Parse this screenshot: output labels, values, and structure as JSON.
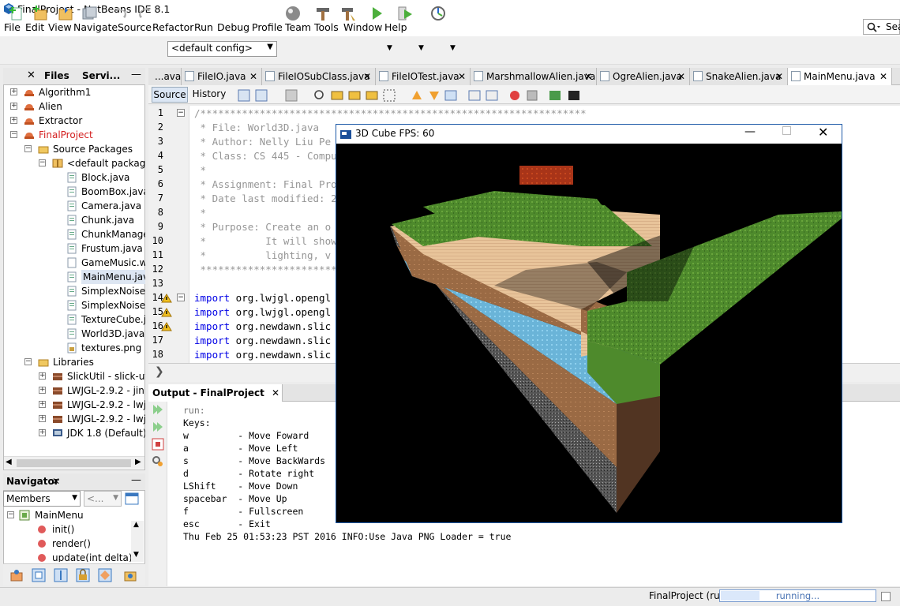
{
  "window": {
    "title": "FinalProject - NetBeans IDE 8.1"
  },
  "menu": [
    "File",
    "Edit",
    "View",
    "Navigate",
    "Source",
    "Refactor",
    "Run",
    "Debug",
    "Profile",
    "Team",
    "Tools",
    "Window",
    "Help"
  ],
  "search": {
    "value": "Sea"
  },
  "toolbar": {
    "config": "<default config>"
  },
  "projects_pane": {
    "tabs": [
      "Files",
      "Servi..."
    ],
    "items": [
      {
        "label": "Algorithm1",
        "level": 0,
        "type": "project"
      },
      {
        "label": "Alien",
        "level": 0,
        "type": "project"
      },
      {
        "label": "Extractor",
        "level": 0,
        "type": "project"
      },
      {
        "label": "FinalProject",
        "level": 0,
        "type": "project-main"
      },
      {
        "label": "Source Packages",
        "level": 1,
        "type": "folder"
      },
      {
        "label": "<default package>",
        "level": 2,
        "type": "package"
      },
      {
        "label": "Block.java",
        "level": 3,
        "type": "java"
      },
      {
        "label": "BoomBox.java",
        "level": 3,
        "type": "java"
      },
      {
        "label": "Camera.java",
        "level": 3,
        "type": "java"
      },
      {
        "label": "Chunk.java",
        "level": 3,
        "type": "java"
      },
      {
        "label": "ChunkManager.j",
        "level": 3,
        "type": "java"
      },
      {
        "label": "Frustum.java",
        "level": 3,
        "type": "java"
      },
      {
        "label": "GameMusic.wav",
        "level": 3,
        "type": "file"
      },
      {
        "label": "MainMenu.java",
        "level": 3,
        "type": "java-selected"
      },
      {
        "label": "SimplexNoise.jav",
        "level": 3,
        "type": "java"
      },
      {
        "label": "SimplexNoise_oc",
        "level": 3,
        "type": "java"
      },
      {
        "label": "TextureCube.jav",
        "level": 3,
        "type": "java"
      },
      {
        "label": "World3D.java",
        "level": 3,
        "type": "java"
      },
      {
        "label": "textures.png",
        "level": 3,
        "type": "image"
      },
      {
        "label": "Libraries",
        "level": 1,
        "type": "folder"
      },
      {
        "label": "SlickUtil - slick-util.jar",
        "level": 2,
        "type": "jar"
      },
      {
        "label": "LWJGL-2.9.2 - jinput",
        "level": 2,
        "type": "jar"
      },
      {
        "label": "LWJGL-2.9.2 - lwjgl.",
        "level": 2,
        "type": "jar"
      },
      {
        "label": "LWJGL-2.9.2 - lwjgl_",
        "level": 2,
        "type": "jar"
      },
      {
        "label": "JDK 1.8 (Default)",
        "level": 2,
        "type": "jdk"
      }
    ]
  },
  "navigator": {
    "title": "Navigator",
    "filter": "Members",
    "filter2": "<...",
    "root": "MainMenu",
    "members": [
      "init()",
      "render()",
      "update(int delta)"
    ]
  },
  "editor": {
    "tabs": [
      "...ava",
      "FileIO.java",
      "FileIOSubClass.java",
      "FileIOTest.java",
      "MarshmallowAlien.java",
      "OgreAlien.java",
      "SnakeAlien.java",
      "MainMenu.java"
    ],
    "source_label": "Source",
    "history_label": "History",
    "line_numbers": [
      "1",
      "2",
      "3",
      "4",
      "5",
      "6",
      "7",
      "8",
      "9",
      "10",
      "11",
      "12",
      "13",
      "14",
      "15",
      "16",
      "17",
      "18"
    ],
    "lines": [
      "/*****************************************************************",
      " * File: World3D.java",
      " * Author: Nelly Liu Pe",
      " * Class: CS 445 - Compu",
      " *",
      " * Assignment: Final Pro",
      " * Date last modified: 2",
      " *",
      " * Purpose: Create an o",
      " *          It will show",
      " *          lighting, v",
      " ****************************************************************/",
      "",
      "import org.lwjgl.opengl",
      "import org.lwjgl.opengl",
      "import org.newdawn.slic",
      "import org.newdawn.slic",
      "import org.newdawn.slic"
    ]
  },
  "output": {
    "tab": "Output - FinalProject (run)",
    "lines": [
      "run:",
      "Keys:",
      "w         - Move Foward",
      "a         - Move Left",
      "s         - Move BackWards",
      "d         - Rotate right",
      "LShift    - Move Down",
      "spacebar  - Move Up",
      "f         - Fullscreen",
      "esc       - Exit",
      "Thu Feb 25 01:53:23 PST 2016 INFO:Use Java PNG Loader = true"
    ]
  },
  "status": {
    "project": "FinalProject (run)",
    "progress_text": "running...",
    "progress": 0.25
  },
  "gl_window": {
    "title": "3D Cube FPS: 60"
  }
}
